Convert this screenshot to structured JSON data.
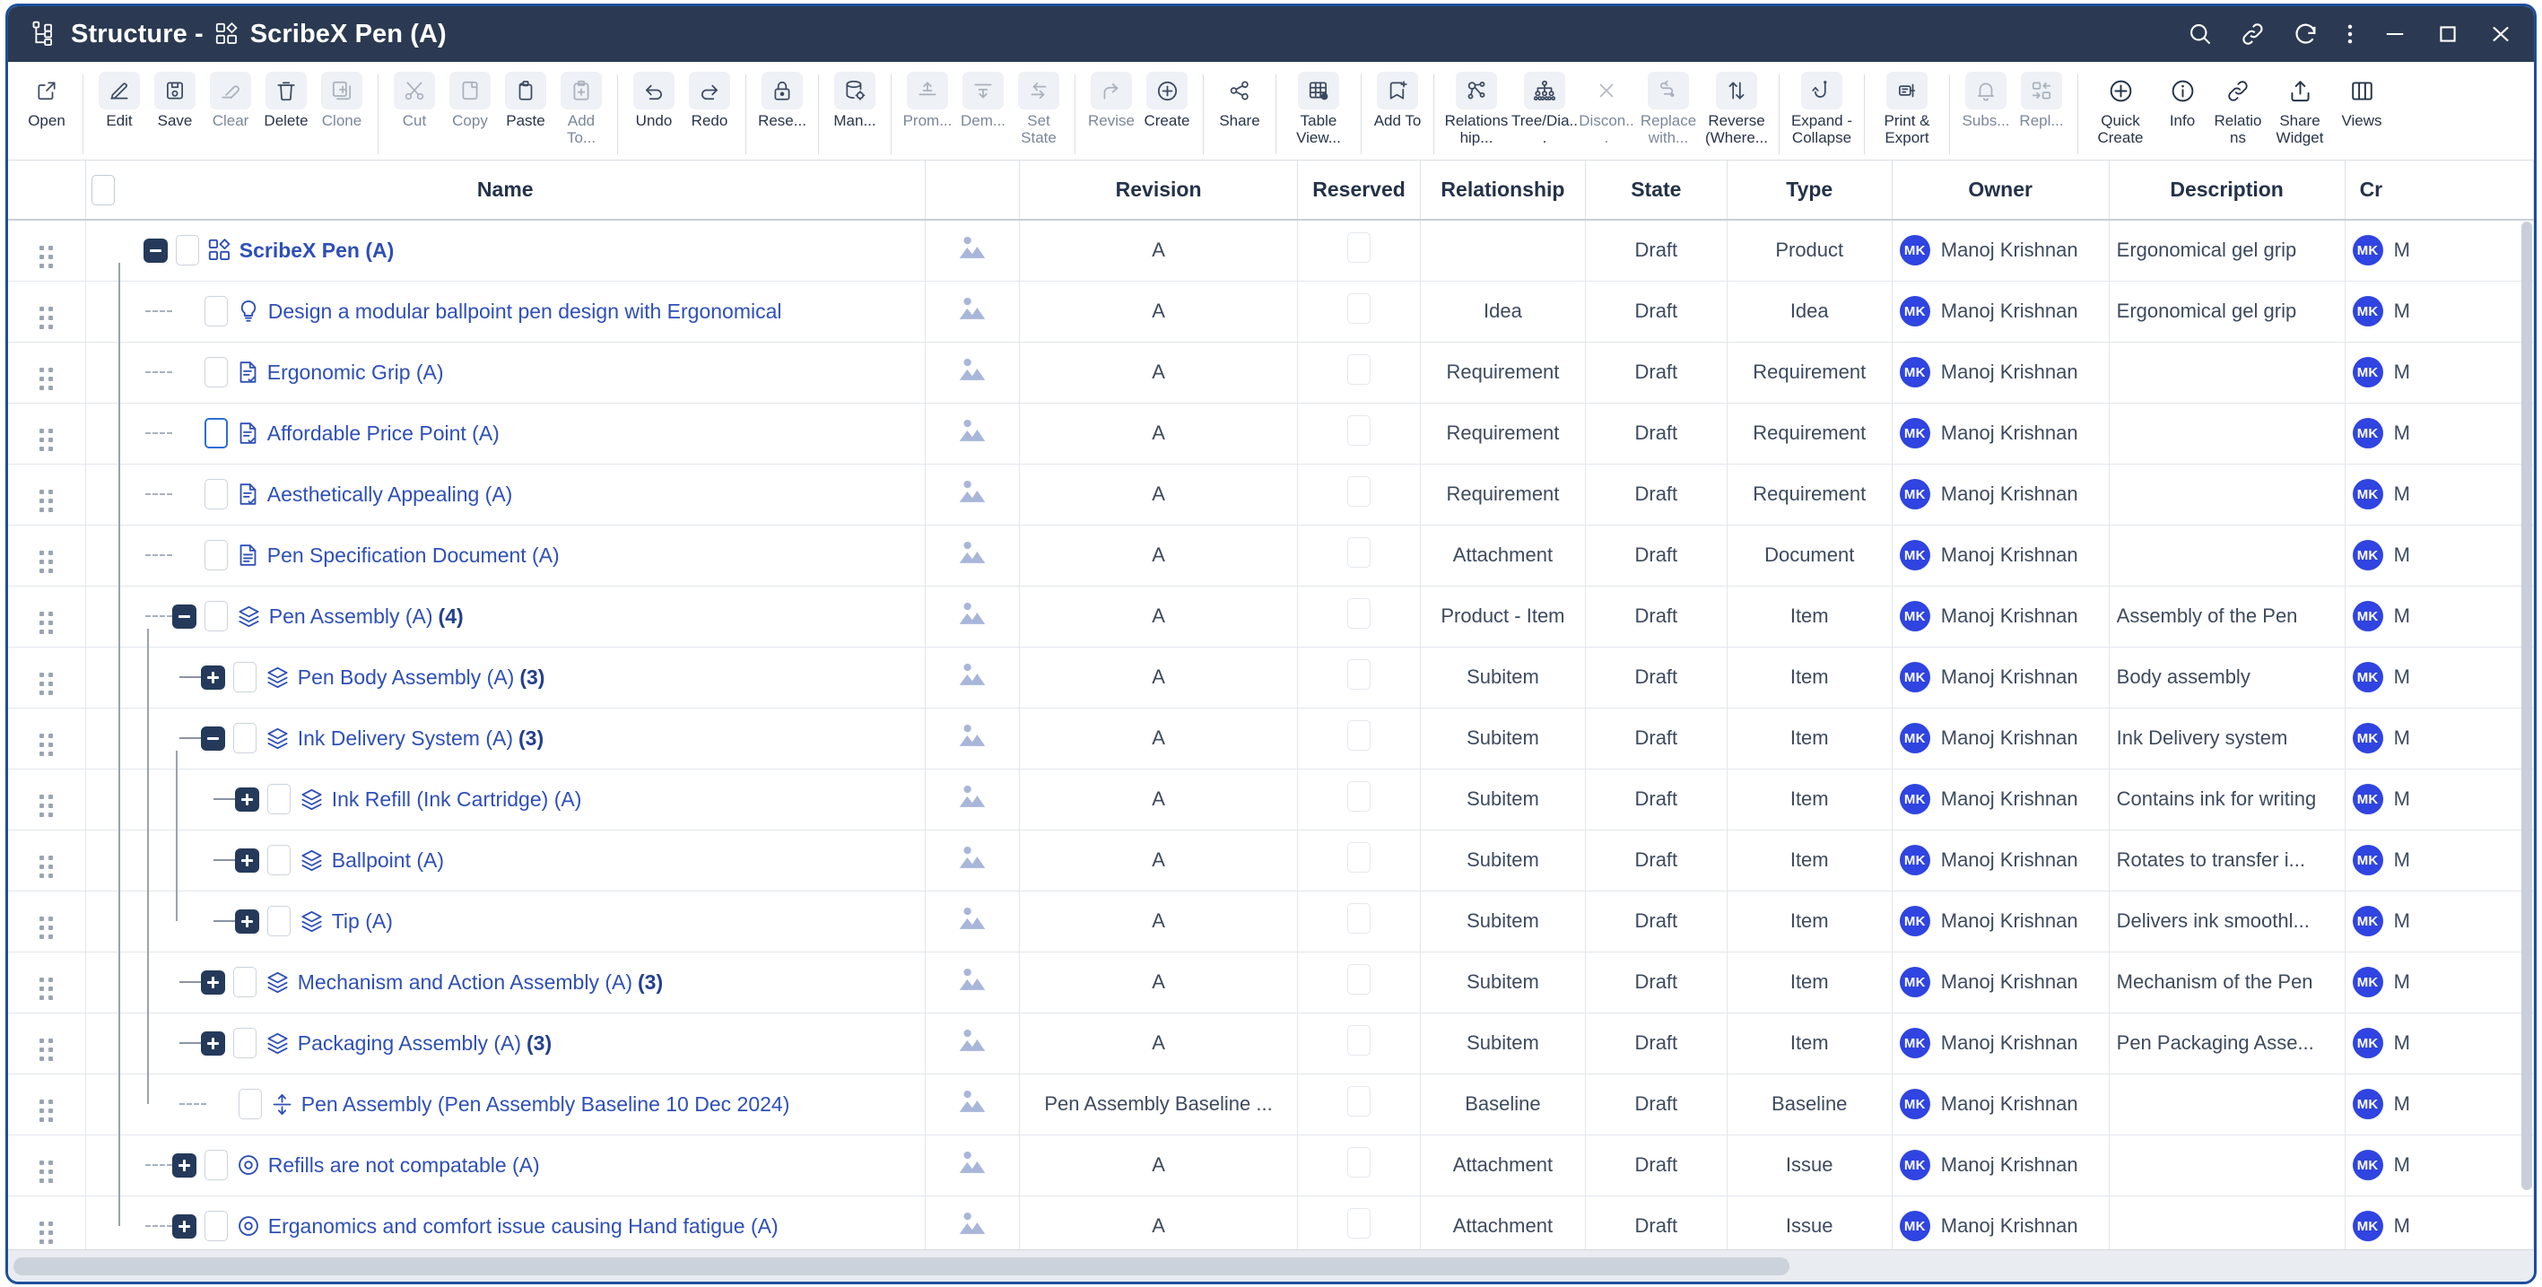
{
  "window": {
    "title_prefix": "Structure - ",
    "title_object": "ScribeX Pen (A)",
    "title_icon": "structure-tree-icon",
    "controls": [
      {
        "name": "search-icon",
        "label": "Search"
      },
      {
        "name": "link-icon",
        "label": "Link"
      },
      {
        "name": "refresh-icon",
        "label": "Refresh"
      },
      {
        "name": "more-vertical-icon",
        "label": "More"
      },
      {
        "name": "minimize-icon",
        "label": "Minimize"
      },
      {
        "name": "maximize-icon",
        "label": "Maximize"
      },
      {
        "name": "close-icon",
        "label": "Close"
      }
    ]
  },
  "toolbar": {
    "groups": [
      {
        "buttons": [
          {
            "label": "Open",
            "icon": "open-external-icon",
            "disabled": false,
            "boxed": false
          }
        ]
      },
      {
        "buttons": [
          {
            "label": "Edit",
            "icon": "pencil-edit-icon",
            "disabled": false,
            "boxed": true
          },
          {
            "label": "Save",
            "icon": "floppy-save-icon",
            "disabled": false,
            "boxed": true
          },
          {
            "label": "Clear",
            "icon": "eraser-icon",
            "disabled": true,
            "boxed": true
          },
          {
            "label": "Delete",
            "icon": "trash-icon",
            "disabled": false,
            "boxed": true
          },
          {
            "label": "Clone",
            "icon": "clone-copy-plus-icon",
            "disabled": true,
            "boxed": true
          }
        ]
      },
      {
        "buttons": [
          {
            "label": "Cut",
            "icon": "scissors-icon",
            "disabled": true,
            "boxed": true
          },
          {
            "label": "Copy",
            "icon": "copy-page-icon",
            "disabled": true,
            "boxed": true
          },
          {
            "label": "Paste",
            "icon": "clipboard-paste-icon",
            "disabled": false,
            "boxed": true
          },
          {
            "label": "Add To...",
            "icon": "clipboard-plus-icon",
            "disabled": true,
            "boxed": true
          }
        ]
      },
      {
        "buttons": [
          {
            "label": "Undo",
            "icon": "undo-arrow-icon",
            "disabled": false,
            "boxed": true
          },
          {
            "label": "Redo",
            "icon": "redo-arrow-icon",
            "disabled": false,
            "boxed": true
          }
        ]
      },
      {
        "buttons": [
          {
            "label": "Rese...",
            "icon": "lock-reserve-icon",
            "disabled": false,
            "boxed": true
          }
        ]
      },
      {
        "buttons": [
          {
            "label": "Man...",
            "icon": "database-gear-icon",
            "disabled": false,
            "boxed": true
          }
        ]
      },
      {
        "buttons": [
          {
            "label": "Prom...",
            "icon": "promote-up-icon",
            "disabled": true,
            "boxed": true
          },
          {
            "label": "Dem...",
            "icon": "demote-down-icon",
            "disabled": true,
            "boxed": true
          },
          {
            "label": "Set State",
            "icon": "set-state-arrows-icon",
            "disabled": true,
            "boxed": true
          }
        ]
      },
      {
        "buttons": [
          {
            "label": "Revise",
            "icon": "revise-branch-icon",
            "disabled": true,
            "boxed": true
          },
          {
            "label": "Create",
            "icon": "create-plus-circle-icon",
            "disabled": false,
            "boxed": true
          }
        ]
      },
      {
        "buttons": [
          {
            "label": "Share",
            "icon": "share-nodes-icon",
            "disabled": false,
            "boxed": false
          }
        ]
      },
      {
        "buttons": [
          {
            "label": "Table View...",
            "icon": "table-view-icon",
            "disabled": false,
            "boxed": true
          }
        ]
      },
      {
        "buttons": [
          {
            "label": "Add To",
            "icon": "bookmark-add-icon",
            "disabled": false,
            "boxed": true
          }
        ]
      },
      {
        "buttons": [
          {
            "label": "Relationship...",
            "icon": "relationship-nodes-icon",
            "disabled": false,
            "boxed": true
          },
          {
            "label": "Tree/Dia...",
            "icon": "tree-diagram-icon",
            "disabled": false,
            "boxed": true
          },
          {
            "label": "Discon...",
            "icon": "disconnect-x-icon",
            "disabled": true,
            "boxed": false
          },
          {
            "label": "Replace with...",
            "icon": "replace-path-icon",
            "disabled": true,
            "boxed": true
          },
          {
            "label": "Reverse (Where...",
            "icon": "reverse-updown-icon",
            "disabled": false,
            "boxed": true
          }
        ]
      },
      {
        "buttons": [
          {
            "label": "Expand - Collapse",
            "icon": "expand-collapse-hook-icon",
            "disabled": false,
            "boxed": true
          }
        ]
      },
      {
        "buttons": [
          {
            "label": "Print & Export",
            "icon": "print-export-icon",
            "disabled": false,
            "boxed": true
          }
        ]
      },
      {
        "buttons": [
          {
            "label": "Subs...",
            "icon": "bell-subscribe-icon",
            "disabled": true,
            "boxed": true
          },
          {
            "label": "Repl...",
            "icon": "replace-swap-icon",
            "disabled": true,
            "boxed": true
          }
        ]
      },
      {
        "buttons": [
          {
            "label": "Quick Create",
            "icon": "quick-create-plus-icon",
            "disabled": false,
            "boxed": false
          },
          {
            "label": "Info",
            "icon": "info-circle-icon",
            "disabled": false,
            "boxed": false
          },
          {
            "label": "Relations",
            "icon": "chain-link-icon",
            "disabled": false,
            "boxed": false
          },
          {
            "label": "Share Widget",
            "icon": "share-upload-icon",
            "disabled": false,
            "boxed": false
          },
          {
            "label": "Views",
            "icon": "columns-views-icon",
            "disabled": false,
            "boxed": false
          }
        ]
      }
    ]
  },
  "table": {
    "columns": [
      {
        "key": "grip",
        "label": ""
      },
      {
        "key": "name",
        "label": "Name"
      },
      {
        "key": "image",
        "label": ""
      },
      {
        "key": "revision",
        "label": "Revision"
      },
      {
        "key": "reserved",
        "label": "Reserved"
      },
      {
        "key": "relationship",
        "label": "Relationship"
      },
      {
        "key": "state",
        "label": "State"
      },
      {
        "key": "type",
        "label": "Type"
      },
      {
        "key": "owner",
        "label": "Owner"
      },
      {
        "key": "description",
        "label": "Description"
      },
      {
        "key": "created",
        "label": "Cr"
      }
    ],
    "rows": [
      {
        "name": "ScribeX Pen (A)",
        "count": "",
        "icon": "product-blocks-icon",
        "depth": 0,
        "toggle": "minus",
        "connector": "none",
        "bold": true,
        "checkbox": "normal",
        "revision": "A",
        "relationship": "",
        "state": "Draft",
        "type": "Product",
        "owner": "Manoj Krishnan",
        "owner_initials": "MK",
        "description": "Ergonomical gel grip",
        "created": "M",
        "created_initials": "MK"
      },
      {
        "name": "Design a modular ballpoint pen design with Ergonomical",
        "count": "",
        "icon": "idea-bulb-icon",
        "depth": 1,
        "toggle": "none",
        "connector": "dash",
        "bold": false,
        "checkbox": "normal",
        "revision": "A",
        "relationship": "Idea",
        "state": "Draft",
        "type": "Idea",
        "owner": "Manoj Krishnan",
        "owner_initials": "MK",
        "description": "Ergonomical gel grip",
        "created": "M",
        "created_initials": "MK"
      },
      {
        "name": "Ergonomic Grip (A)",
        "count": "",
        "icon": "requirement-doc-icon",
        "depth": 1,
        "toggle": "none",
        "connector": "dash",
        "bold": false,
        "checkbox": "normal",
        "revision": "A",
        "relationship": "Requirement",
        "state": "Draft",
        "type": "Requirement",
        "owner": "Manoj Krishnan",
        "owner_initials": "MK",
        "description": "",
        "created": "M",
        "created_initials": "MK"
      },
      {
        "name": "Affordable Price Point (A)",
        "count": "",
        "icon": "requirement-doc-icon",
        "depth": 1,
        "toggle": "none",
        "connector": "dash",
        "bold": false,
        "checkbox": "highlight",
        "revision": "A",
        "relationship": "Requirement",
        "state": "Draft",
        "type": "Requirement",
        "owner": "Manoj Krishnan",
        "owner_initials": "MK",
        "description": "",
        "created": "M",
        "created_initials": "MK"
      },
      {
        "name": "Aesthetically Appealing (A)",
        "count": "",
        "icon": "requirement-doc-icon",
        "depth": 1,
        "toggle": "none",
        "connector": "dash",
        "bold": false,
        "checkbox": "normal",
        "revision": "A",
        "relationship": "Requirement",
        "state": "Draft",
        "type": "Requirement",
        "owner": "Manoj Krishnan",
        "owner_initials": "MK",
        "description": "",
        "created": "M",
        "created_initials": "MK"
      },
      {
        "name": "Pen Specification Document (A)",
        "count": "",
        "icon": "document-icon",
        "depth": 1,
        "toggle": "none",
        "connector": "dash",
        "bold": false,
        "checkbox": "normal",
        "revision": "A",
        "relationship": "Attachment",
        "state": "Draft",
        "type": "Document",
        "owner": "Manoj Krishnan",
        "owner_initials": "MK",
        "description": "",
        "created": "M",
        "created_initials": "MK"
      },
      {
        "name": "Pen Assembly (A)",
        "count": "(4)",
        "icon": "assembly-layers-icon",
        "depth": 1,
        "toggle": "minus",
        "connector": "dash",
        "bold": false,
        "checkbox": "normal",
        "revision": "A",
        "relationship": "Product - Item",
        "state": "Draft",
        "type": "Item",
        "owner": "Manoj Krishnan",
        "owner_initials": "MK",
        "description": "Assembly of the Pen",
        "created": "M",
        "created_initials": "MK"
      },
      {
        "name": "Pen Body Assembly (A)",
        "count": "(3)",
        "icon": "assembly-layers-icon",
        "depth": 2,
        "toggle": "plus",
        "connector": "solid",
        "bold": false,
        "checkbox": "normal",
        "revision": "A",
        "relationship": "Subitem",
        "state": "Draft",
        "type": "Item",
        "owner": "Manoj Krishnan",
        "owner_initials": "MK",
        "description": "Body assembly",
        "created": "M",
        "created_initials": "MK"
      },
      {
        "name": "Ink Delivery System (A)",
        "count": "(3)",
        "icon": "assembly-layers-icon",
        "depth": 2,
        "toggle": "minus",
        "connector": "solid",
        "bold": false,
        "checkbox": "normal",
        "revision": "A",
        "relationship": "Subitem",
        "state": "Draft",
        "type": "Item",
        "owner": "Manoj Krishnan",
        "owner_initials": "MK",
        "description": "Ink Delivery system",
        "created": "M",
        "created_initials": "MK"
      },
      {
        "name": "Ink Refill (Ink Cartridge) (A)",
        "count": "",
        "icon": "assembly-layers-icon",
        "depth": 3,
        "toggle": "plus",
        "connector": "solid",
        "bold": false,
        "checkbox": "normal",
        "revision": "A",
        "relationship": "Subitem",
        "state": "Draft",
        "type": "Item",
        "owner": "Manoj Krishnan",
        "owner_initials": "MK",
        "description": "Contains ink for writing",
        "created": "M",
        "created_initials": "MK"
      },
      {
        "name": "Ballpoint (A)",
        "count": "",
        "icon": "assembly-layers-icon",
        "depth": 3,
        "toggle": "plus",
        "connector": "solid",
        "bold": false,
        "checkbox": "normal",
        "revision": "A",
        "relationship": "Subitem",
        "state": "Draft",
        "type": "Item",
        "owner": "Manoj Krishnan",
        "owner_initials": "MK",
        "description": "Rotates to transfer i...",
        "created": "M",
        "created_initials": "MK"
      },
      {
        "name": "Tip (A)",
        "count": "",
        "icon": "assembly-layers-icon",
        "depth": 3,
        "toggle": "plus",
        "connector": "solid",
        "bold": false,
        "checkbox": "normal",
        "revision": "A",
        "relationship": "Subitem",
        "state": "Draft",
        "type": "Item",
        "owner": "Manoj Krishnan",
        "owner_initials": "MK",
        "description": "Delivers ink smoothl...",
        "created": "M",
        "created_initials": "MK"
      },
      {
        "name": "Mechanism and Action Assembly (A)",
        "count": "(3)",
        "icon": "assembly-layers-icon",
        "depth": 2,
        "toggle": "plus",
        "connector": "solid",
        "bold": false,
        "checkbox": "normal",
        "revision": "A",
        "relationship": "Subitem",
        "state": "Draft",
        "type": "Item",
        "owner": "Manoj Krishnan",
        "owner_initials": "MK",
        "description": "Mechanism of the Pen",
        "created": "M",
        "created_initials": "MK"
      },
      {
        "name": "Packaging Assembly (A)",
        "count": "(3)",
        "icon": "assembly-layers-icon",
        "depth": 2,
        "toggle": "plus",
        "connector": "solid",
        "bold": false,
        "checkbox": "normal",
        "revision": "A",
        "relationship": "Subitem",
        "state": "Draft",
        "type": "Item",
        "owner": "Manoj Krishnan",
        "owner_initials": "MK",
        "description": "Pen Packaging Asse...",
        "created": "M",
        "created_initials": "MK"
      },
      {
        "name": "Pen Assembly (Pen Assembly Baseline 10 Dec 2024)",
        "count": "",
        "icon": "baseline-marker-icon",
        "depth": 2,
        "toggle": "none",
        "connector": "dash",
        "bold": false,
        "checkbox": "normal",
        "revision": "Pen Assembly Baseline ...",
        "relationship": "Baseline",
        "state": "Draft",
        "type": "Baseline",
        "owner": "Manoj Krishnan",
        "owner_initials": "MK",
        "description": "",
        "created": "M",
        "created_initials": "MK"
      },
      {
        "name": "Refills are not compatable (A)",
        "count": "",
        "icon": "issue-target-icon",
        "depth": 1,
        "toggle": "plus",
        "connector": "dash",
        "bold": false,
        "checkbox": "normal",
        "revision": "A",
        "relationship": "Attachment",
        "state": "Draft",
        "type": "Issue",
        "owner": "Manoj Krishnan",
        "owner_initials": "MK",
        "description": "",
        "created": "M",
        "created_initials": "MK"
      },
      {
        "name": "Erganomics and comfort issue causing Hand fatigue (A)",
        "count": "",
        "icon": "issue-target-icon",
        "depth": 1,
        "toggle": "plus",
        "connector": "dash",
        "bold": false,
        "checkbox": "normal",
        "revision": "A",
        "relationship": "Attachment",
        "state": "Draft",
        "type": "Issue",
        "owner": "Manoj Krishnan",
        "owner_initials": "MK",
        "description": "",
        "created": "M",
        "created_initials": "MK"
      }
    ]
  },
  "colors": {
    "titlebar": "#2b3a52",
    "window_border": "#1b4f9c",
    "link": "#2e4fb8",
    "avatar": "#2f44e0",
    "toggle": "#253a5b"
  }
}
